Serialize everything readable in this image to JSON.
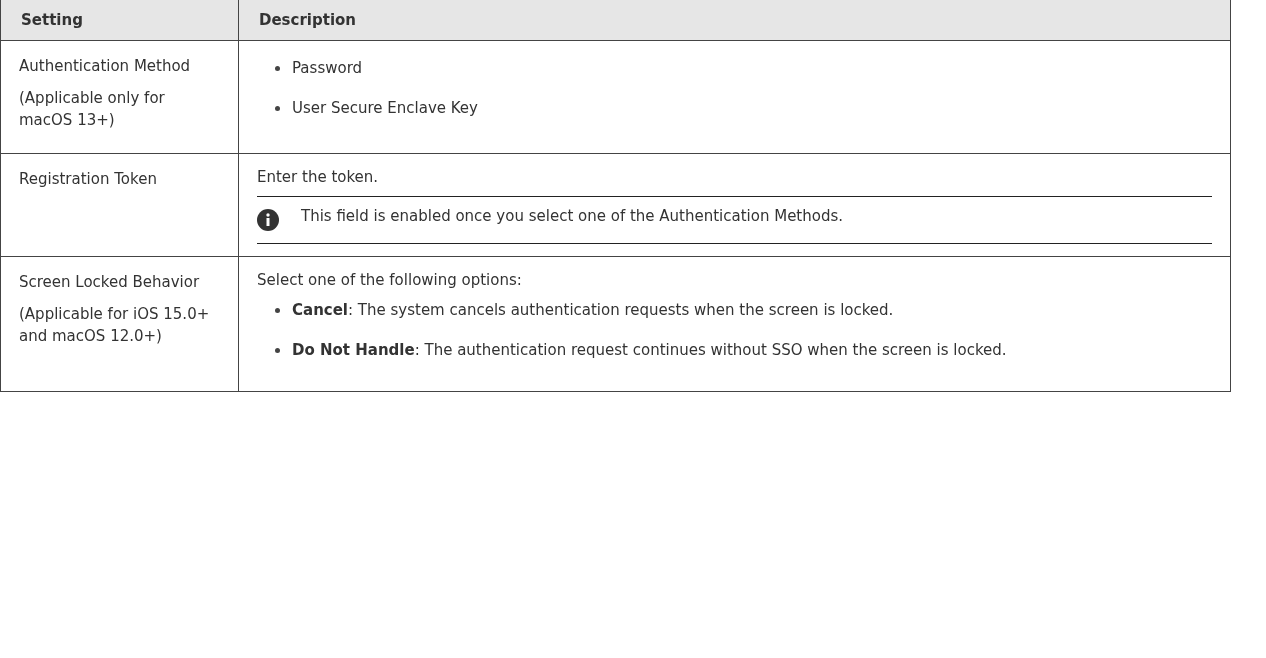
{
  "table": {
    "columns": [
      "Setting",
      "Description"
    ],
    "rows": [
      {
        "setting": [
          "Authentication Method",
          "(Applicable only for macOS 13+)"
        ],
        "description": [
          {
            "kind": "list",
            "items": [
              "Password",
              "User Secure Enclave Key"
            ]
          }
        ]
      },
      {
        "setting": [
          "Registration Token"
        ],
        "description": [
          {
            "kind": "paragraph",
            "text": "Enter the token."
          },
          {
            "kind": "note",
            "text": "This field is enabled once you select one of the Authentication Methods."
          }
        ]
      },
      {
        "setting": [
          "Screen Locked Behavior",
          "(Applicable for iOS 15.0+ and macOS 12.0+)"
        ],
        "description": [
          {
            "kind": "paragraph",
            "text": "Select one of the following options:"
          },
          {
            "kind": "list",
            "items": [
              "**Cancel**: The system cancels authentication requests when the screen is locked.",
              "**Do Not Handle**: The authentication request continues without SSO when the screen is locked."
            ]
          }
        ]
      }
    ]
  }
}
